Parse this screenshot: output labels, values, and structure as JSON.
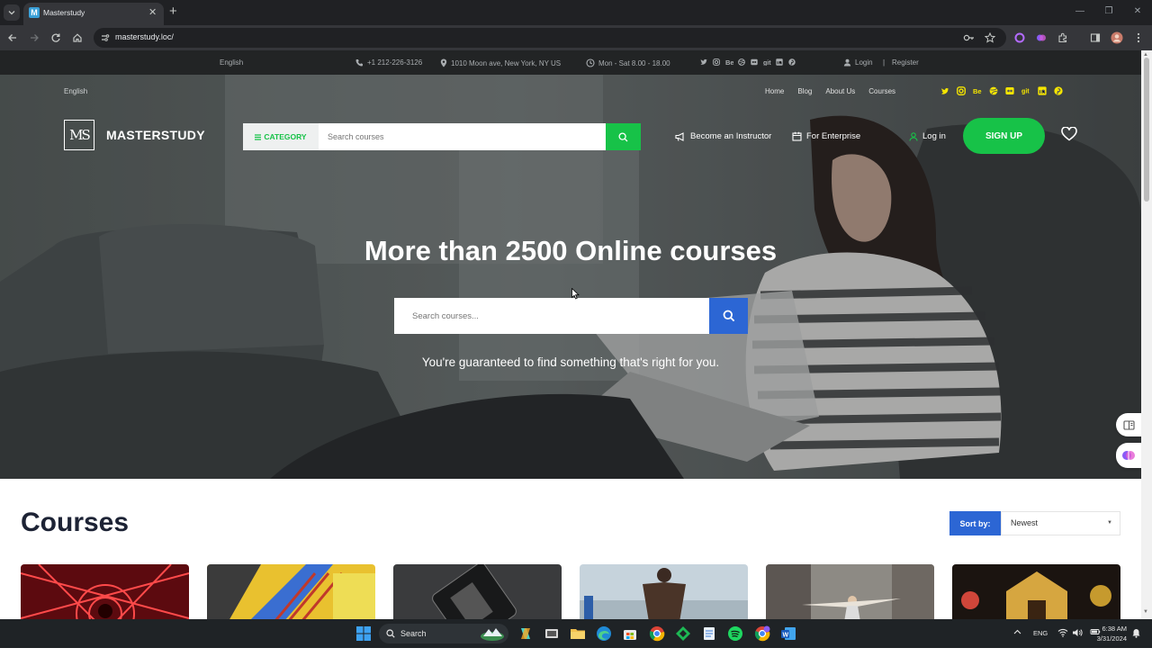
{
  "browser": {
    "tab_title": "Masterstudy",
    "tab_favicon_letter": "M",
    "url": "masterstudy.loc/"
  },
  "infobar": {
    "language": "English",
    "phone": "+1 212-226-3126",
    "address": "1010 Moon ave, New York, NY US",
    "hours": "Mon - Sat 8.00 - 18.00",
    "login": "Login",
    "separator": "|",
    "register": "Register"
  },
  "hero_nav": {
    "language": "English",
    "links": [
      "Home",
      "Blog",
      "About Us",
      "Courses"
    ]
  },
  "header": {
    "logo_mark": "MS",
    "logo_text": "MASTERSTUDY",
    "category_label": "CATEGORY",
    "search_placeholder": "Search courses",
    "become_instructor": "Become an Instructor",
    "enterprise": "For Enterprise",
    "login": "Log in",
    "signup": "SIGN UP"
  },
  "hero": {
    "title": "More than 2500 Online courses",
    "search_placeholder": "Search courses...",
    "subtitle": "You're guaranteed to find something that's right for you."
  },
  "courses": {
    "title": "Courses",
    "sort_label": "Sort by:",
    "sort_value": "Newest"
  },
  "taskbar": {
    "search_label": "Search",
    "language": "ENG",
    "time": "6:38 AM",
    "date": "3/31/2024"
  },
  "colors": {
    "brand_green": "#17c248",
    "brand_blue": "#2c66d4",
    "social_yellow": "#f5e500",
    "heading_dark": "#1d2335"
  }
}
